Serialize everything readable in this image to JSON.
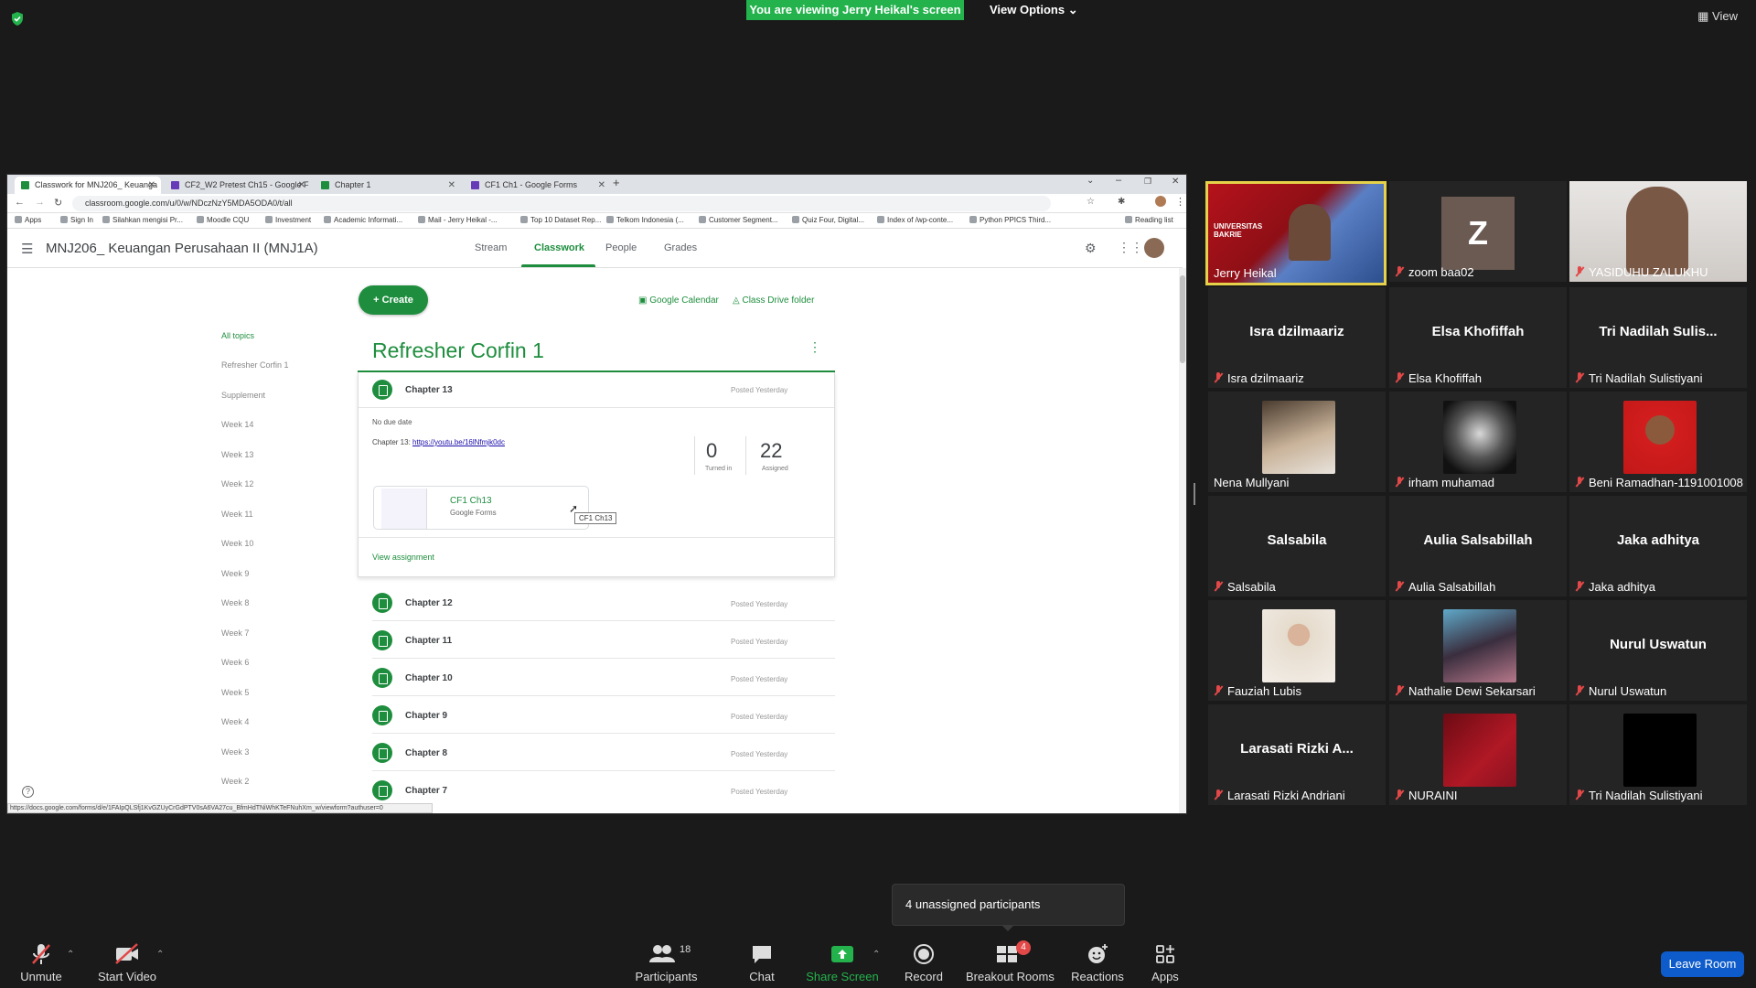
{
  "banner": {
    "viewing_text": "You are viewing Jerry Heikal's screen",
    "view_options": "View Options",
    "view_label": "View"
  },
  "browser": {
    "tabs": [
      {
        "label": "Classwork for MNJ206_ Keuanga",
        "color": "#1e8e3e"
      },
      {
        "label": "CF2_W2 Pretest Ch15 - Google F",
        "color": "#673ab7"
      },
      {
        "label": "Chapter 1",
        "color": "#1e8e3e"
      },
      {
        "label": "CF1 Ch1 - Google Forms",
        "color": "#673ab7"
      }
    ],
    "url": "classroom.google.com/u/0/w/NDczNzY5MDA5ODA0/t/all",
    "bookmarks": [
      "Apps",
      "Sign In",
      "Silahkan mengisi Pr...",
      "Moodle CQU",
      "Investment",
      "Academic Informati...",
      "Mail - Jerry Heikal -...",
      "Top 10 Dataset Rep...",
      "Telkom Indonesia (...",
      "Customer Segment...",
      "Quiz Four, Digital...",
      "Index of /wp-conte...",
      "Python PPICS Third..."
    ],
    "reading_list": "Reading list",
    "status_url": "https://docs.google.com/forms/d/e/1FAIpQLSfj1KvGZUyCrGdPTV0sA6VA27cu_BfmHdTNiWhKTeFNuhXm_w/viewform?authuser=0"
  },
  "classroom": {
    "course_title": "MNJ206_ Keuangan Perusahaan II (MNJ1A)",
    "nav": [
      "Stream",
      "Classwork",
      "People",
      "Grades"
    ],
    "create_label": "Create",
    "calendar_link": "Google Calendar",
    "drive_link": "Class Drive folder",
    "topics": [
      "All topics",
      "Refresher Corfin 1",
      "Supplement",
      "Week 14",
      "Week 13",
      "Week 12",
      "Week 11",
      "Week 10",
      "Week 9",
      "Week 8",
      "Week 7",
      "Week 6",
      "Week 5",
      "Week 4",
      "Week 3",
      "Week 2"
    ],
    "section_title": "Refresher Corfin 1",
    "expanded": {
      "title": "Chapter 13",
      "posted": "Posted Yesterday",
      "due": "No due date",
      "desc_prefix": "Chapter 13: ",
      "desc_link": "https://youtu.be/16lNfmjk0dc",
      "turned_in": "0",
      "turned_in_label": "Turned in",
      "assigned": "22",
      "assigned_label": "Assigned",
      "attachment_title": "CF1 Ch13",
      "attachment_type": "Google Forms",
      "tooltip": "CF1 Ch13",
      "view_link": "View assignment"
    },
    "assignments": [
      {
        "title": "Chapter 12",
        "posted": "Posted Yesterday"
      },
      {
        "title": "Chapter 11",
        "posted": "Posted Yesterday"
      },
      {
        "title": "Chapter 10",
        "posted": "Posted Yesterday"
      },
      {
        "title": "Chapter 9",
        "posted": "Posted Yesterday"
      },
      {
        "title": "Chapter 8",
        "posted": "Posted Yesterday"
      },
      {
        "title": "Chapter 7",
        "posted": "Posted Yesterday"
      }
    ]
  },
  "participants": [
    {
      "name": "Jerry Heikal",
      "type": "video",
      "muted": false,
      "speaker": true,
      "poster_text": "UNIVERSITAS BAKRIE"
    },
    {
      "name": "zoom baa02",
      "type": "avatar",
      "muted": true,
      "initial": "Z"
    },
    {
      "name": "YASIDUHU ZALUKHU",
      "type": "video",
      "muted": true
    },
    {
      "name": "Isra dzilmaariz",
      "type": "text",
      "muted": true,
      "display": "Isra dzilmaariz"
    },
    {
      "name": "Elsa Khofiffah",
      "type": "text",
      "muted": true,
      "display": "Elsa Khofiffah"
    },
    {
      "name": "Tri Nadilah Sulistiyani",
      "type": "text",
      "muted": true,
      "display": "Tri  Nadilah  Sulis..."
    },
    {
      "name": "Nena Mullyani",
      "type": "photo",
      "muted": false
    },
    {
      "name": "irham muhamad",
      "type": "photo",
      "muted": true
    },
    {
      "name": "Beni Ramadhan-1191001008",
      "type": "photo",
      "muted": true
    },
    {
      "name": "Salsabila",
      "type": "text",
      "muted": true,
      "display": "Salsabila"
    },
    {
      "name": "Aulia Salsabillah",
      "type": "text",
      "muted": true,
      "display": "Aulia Salsabillah"
    },
    {
      "name": "Jaka adhitya",
      "type": "text",
      "muted": true,
      "display": "Jaka adhitya"
    },
    {
      "name": "Fauziah Lubis",
      "type": "photo",
      "muted": true
    },
    {
      "name": "Nathalie Dewi Sekarsari",
      "type": "photo",
      "muted": true
    },
    {
      "name": "Nurul Uswatun",
      "type": "text",
      "muted": true,
      "display": "Nurul Uswatun"
    },
    {
      "name": "Larasati Rizki Andriani",
      "type": "text",
      "muted": true,
      "display": "Larasati  Rizki  A..."
    },
    {
      "name": "NURAINI",
      "type": "photo",
      "muted": true
    },
    {
      "name": "Tri Nadilah Sulistiyani",
      "type": "photo",
      "muted": true
    }
  ],
  "popup": {
    "unassigned": "4 unassigned participants"
  },
  "toolbar": {
    "unmute": "Unmute",
    "start_video": "Start Video",
    "participants": "Participants",
    "participants_count": "18",
    "chat": "Chat",
    "share_screen": "Share Screen",
    "record": "Record",
    "breakout_rooms": "Breakout Rooms",
    "breakout_badge": "4",
    "reactions": "Reactions",
    "apps": "Apps",
    "leave": "Leave Room"
  },
  "colors": {
    "zoom_green": "#23b24c",
    "classroom_green": "#1e8e3e",
    "leave_blue": "#0e5ccb",
    "speaker_border": "#e6d24a",
    "mute_red": "#e24848"
  }
}
